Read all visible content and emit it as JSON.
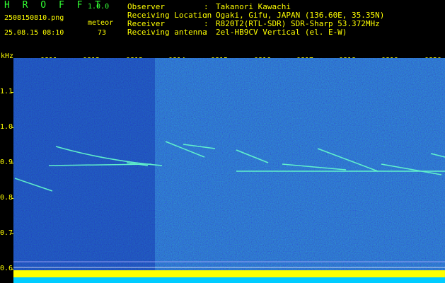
{
  "app": {
    "name": "H R O F F T",
    "version": "1.0.0"
  },
  "file": {
    "name": "2508150810.png",
    "datetime": "25.08.15 08:10"
  },
  "meteor": {
    "label": "meteor",
    "count": "73"
  },
  "info": [
    {
      "label": "Observer",
      "value": "Takanori Kawachi"
    },
    {
      "label": "Receiving Location",
      "value": "Ogaki, Gifu, JAPAN (136.60E, 35.35N)"
    },
    {
      "label": "Receiver",
      "value": "R820T2(RTL-SDR) SDR-Sharp 53.372MHz"
    },
    {
      "label": "Receiving antenna",
      "value": "2el-HB9CV Vertical (el. E-W)"
    }
  ],
  "axis": {
    "y_unit": "kHz",
    "y_ticks": [
      "1.1",
      "1.0",
      "0.9",
      "0.8",
      "0.7",
      "0.6"
    ],
    "x_ticks": [
      "0811",
      "0812",
      "0813",
      "0814",
      "0815",
      "0816",
      "0817",
      "0818",
      "0819",
      "0820"
    ]
  },
  "colors": {
    "header_green": "#33ff33",
    "header_yellow": "#ffff00",
    "background": "#00007a",
    "trail": "#66ffcc"
  }
}
